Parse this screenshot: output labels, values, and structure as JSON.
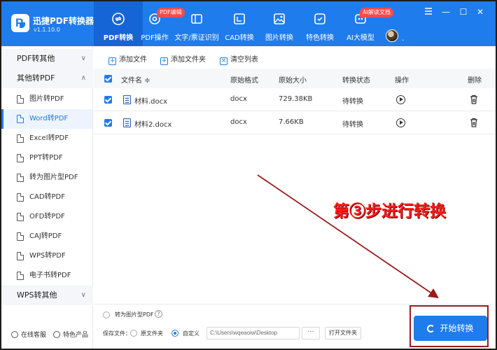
{
  "app": {
    "name": "迅捷PDF转换器",
    "version": "v1.1.10.0"
  },
  "tabs": [
    {
      "label": "PDF转换",
      "icon": "convert-icon"
    },
    {
      "label": "PDF操作",
      "icon": "gear-icon",
      "badge": "PDF编辑"
    },
    {
      "label": "文字/票证识别",
      "icon": "scan-icon"
    },
    {
      "label": "CAD转换",
      "icon": "cad-icon"
    },
    {
      "label": "图片转换",
      "icon": "image-icon"
    },
    {
      "label": "特色转换",
      "icon": "special-icon"
    },
    {
      "label": "AI大模型",
      "icon": "ai-icon",
      "badge": "AI解读文档"
    }
  ],
  "user": {
    "dot": "."
  },
  "window": {
    "minimize": "—",
    "maximize": "☐",
    "close": "✕"
  },
  "sidebar": {
    "sections": {
      "pdf_to_other": "PDF转其他",
      "other_to_pdf": "其他转PDF",
      "wps_to_other": "WPS转其他"
    },
    "items": [
      "图片转PDF",
      "Word转PDF",
      "Excel转PDF",
      "PPT转PDF",
      "转为图片型PDF",
      "CAD转PDF",
      "OFD转PDF",
      "CAJ转PDF",
      "WPS转PDF",
      "电子书转PDF"
    ],
    "footer": {
      "service": "在线客服",
      "products": "特色产品"
    }
  },
  "toolbar": {
    "add_file": "添加文件",
    "add_folder": "添加文件夹",
    "clear_list": "清空列表"
  },
  "table": {
    "headers": {
      "name": "文件名",
      "format": "原始格式",
      "size": "原始大小",
      "status": "转换状态",
      "op": "操作",
      "delete": "删除"
    },
    "sort_mark": "≑",
    "rows": [
      {
        "name": "材料.docx",
        "format": "docx",
        "size": "729.38KB",
        "status": "待转换"
      },
      {
        "name": "材料2.docx",
        "format": "docx",
        "size": "7.66KB",
        "status": "待转换"
      }
    ]
  },
  "bottom": {
    "to_image_pdf": "转为图片型PDF",
    "help": "?",
    "save_label": "保存文件：",
    "opt_original": "原文件夹",
    "opt_custom": "自定义",
    "path": "C:\\Users\\wqeaoiw\\Desktop",
    "browse": "···",
    "open_folder": "打开文件夹",
    "start": "开始转换"
  },
  "annotation": {
    "text": "第③步进行转换",
    "color": "#ff1a1a"
  },
  "colors": {
    "accent": "#1f7cec",
    "accent_dark": "#1565d6",
    "annotation_line": "#9b1a1a"
  }
}
